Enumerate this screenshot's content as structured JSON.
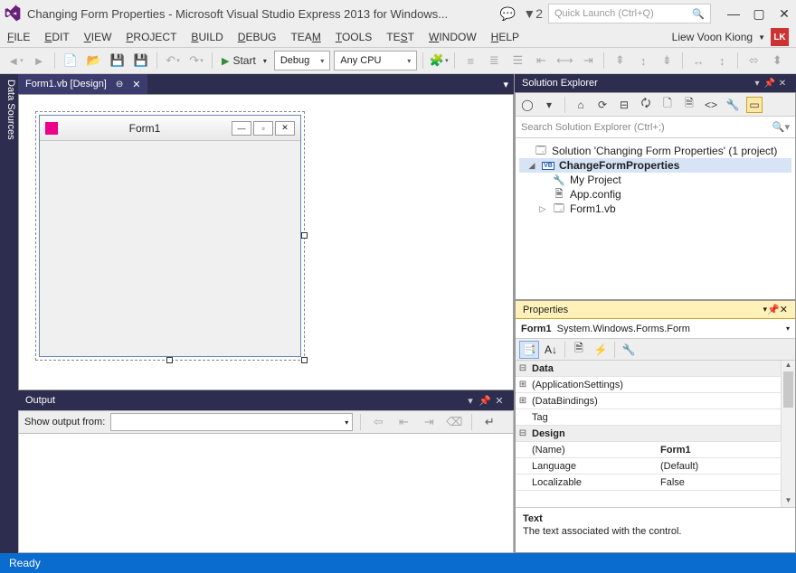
{
  "title": "Changing Form Properties - Microsoft Visual Studio Express 2013 for Windows...",
  "notifications_count": "2",
  "quick_launch_placeholder": "Quick Launch (Ctrl+Q)",
  "menu": [
    "FILE",
    "EDIT",
    "VIEW",
    "PROJECT",
    "BUILD",
    "DEBUG",
    "TEAM",
    "TOOLS",
    "TEST",
    "WINDOW",
    "HELP"
  ],
  "user": {
    "name": "Liew Voon Kiong",
    "initials": "LK"
  },
  "toolbar": {
    "start_label": "Start",
    "config": "Debug",
    "platform": "Any CPU"
  },
  "left_rail": "Data Sources",
  "document_tab": {
    "label": "Form1.vb [Design]"
  },
  "form": {
    "title": "Form1"
  },
  "output": {
    "panel_title": "Output",
    "show_from_label": "Show output from:"
  },
  "solution_explorer": {
    "panel_title": "Solution Explorer",
    "search_placeholder": "Search Solution Explorer (Ctrl+;)",
    "solution_label": "Solution 'Changing Form Properties' (1 project)",
    "project": "ChangeFormProperties",
    "items": [
      "My Project",
      "App.config",
      "Form1.vb"
    ]
  },
  "properties": {
    "panel_title": "Properties",
    "object_name": "Form1",
    "object_type": "System.Windows.Forms.Form",
    "categories": {
      "data": {
        "label": "Data",
        "rows": [
          {
            "k": "(ApplicationSettings)",
            "v": ""
          },
          {
            "k": "(DataBindings)",
            "v": ""
          },
          {
            "k": "Tag",
            "v": ""
          }
        ]
      },
      "design": {
        "label": "Design",
        "rows": [
          {
            "k": "(Name)",
            "v": "Form1",
            "sel": true
          },
          {
            "k": "Language",
            "v": "(Default)"
          },
          {
            "k": "Localizable",
            "v": "False"
          }
        ]
      }
    },
    "desc_title": "Text",
    "desc_body": "The text associated with the control."
  },
  "status": "Ready"
}
